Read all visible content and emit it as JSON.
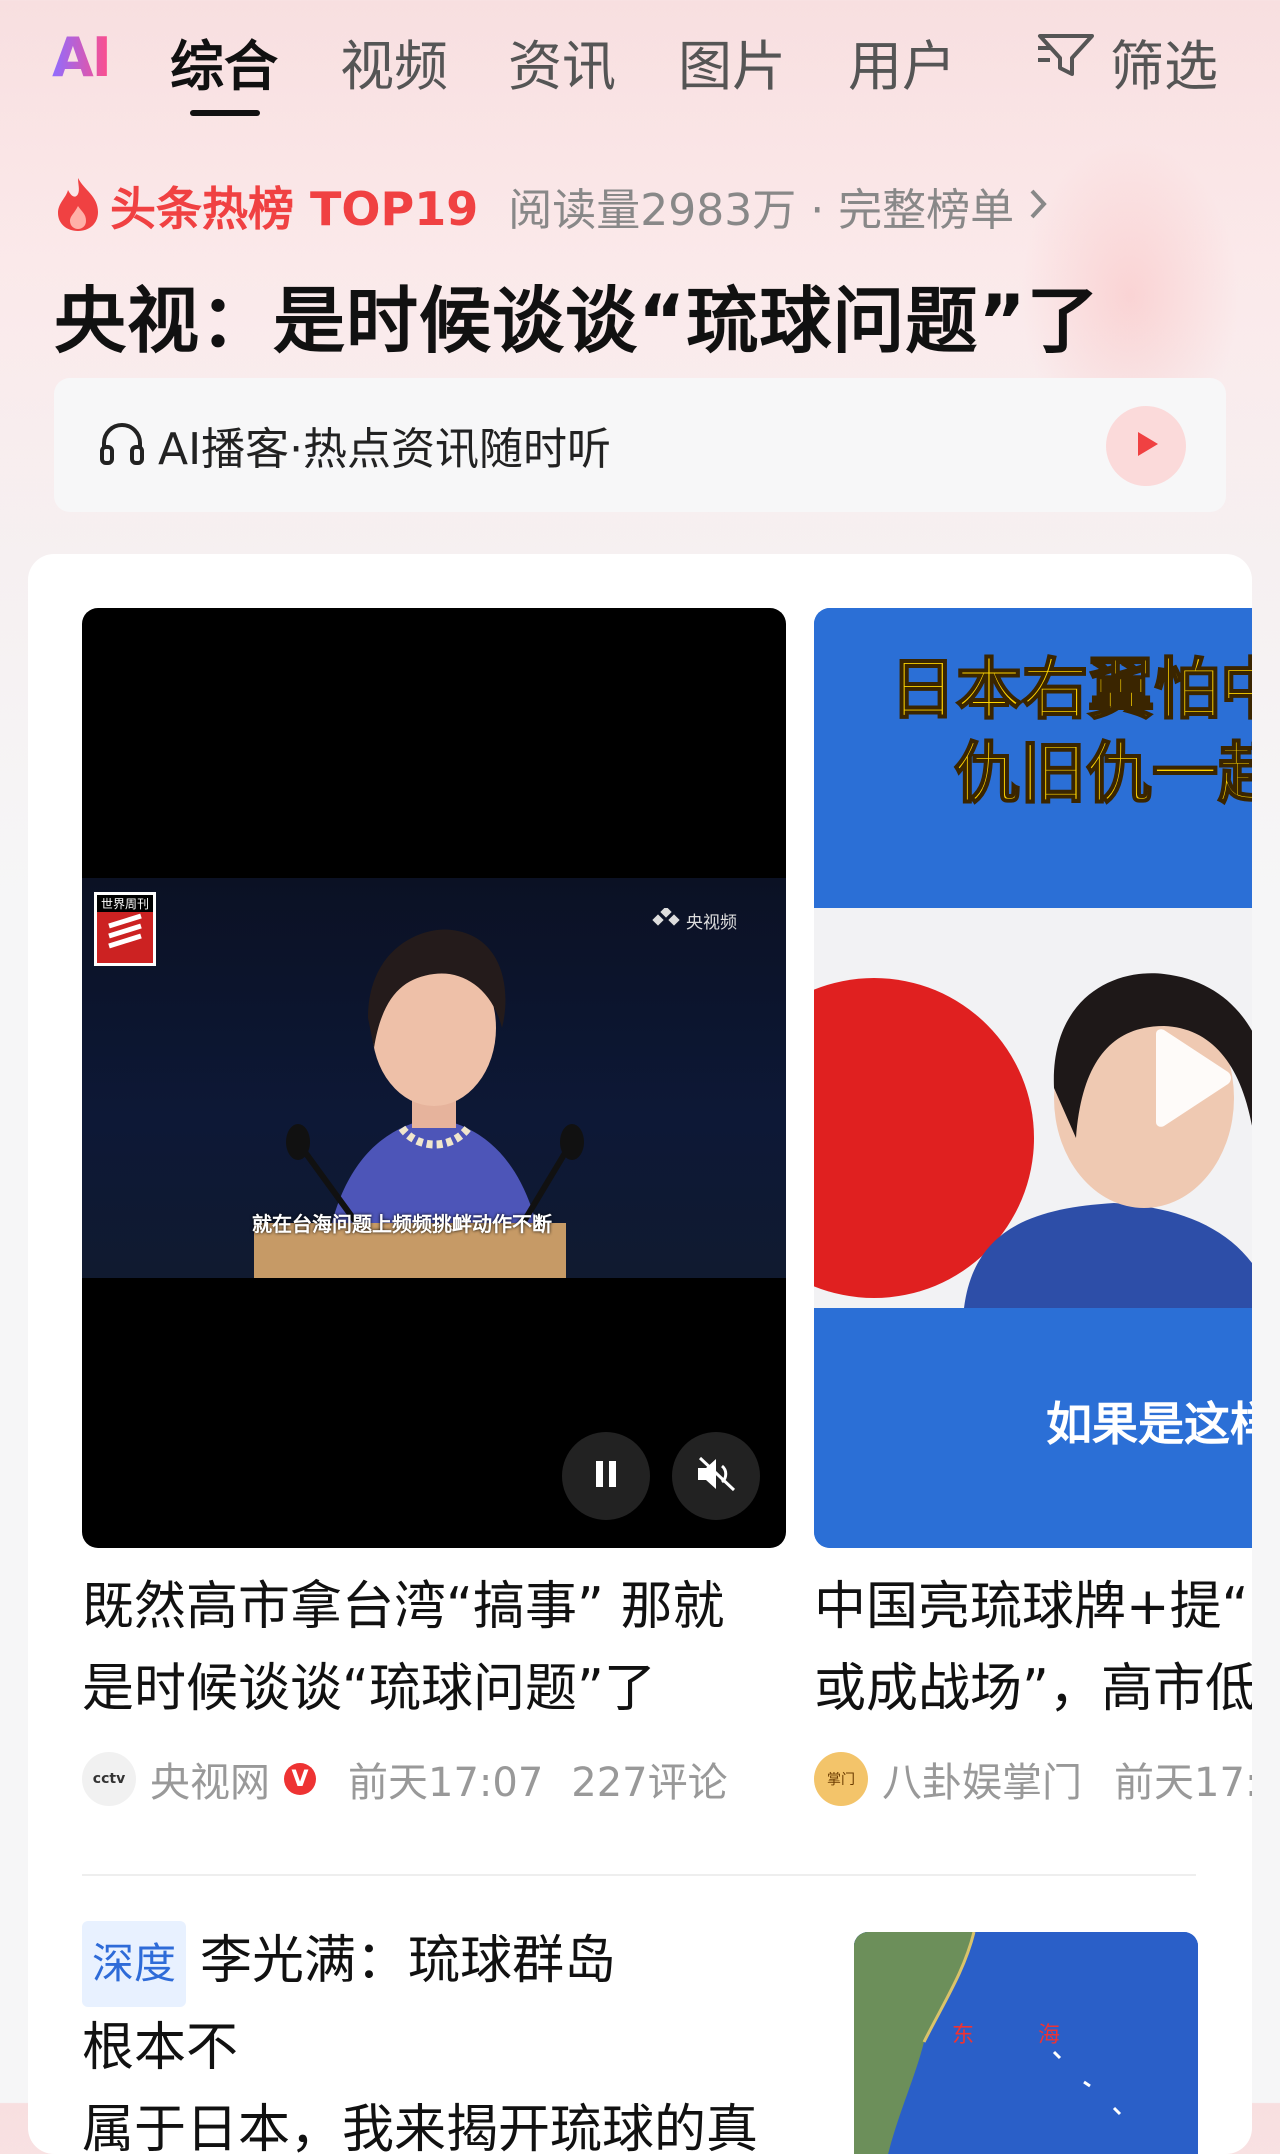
{
  "nav": {
    "logo": "AI",
    "tabs": [
      {
        "label": "综合",
        "active": true
      },
      {
        "label": "视频",
        "active": false
      },
      {
        "label": "资讯",
        "active": false
      },
      {
        "label": "图片",
        "active": false
      },
      {
        "label": "用户",
        "active": false
      }
    ],
    "filter_label": "筛选"
  },
  "hot": {
    "tag": "头条热榜 TOP19",
    "meta": "阅读量2983万 · 完整榜单",
    "headline": "央视：是时候谈谈“琉球问题”了"
  },
  "podcast": {
    "label": "AI播客·热点资讯随时听"
  },
  "videos": [
    {
      "thumb_logo": "世界周刊",
      "thumb_watermark": "央视频",
      "caption": "就在台海问题上频频挑衅动作不断",
      "title_line1": "既然高市拿台湾“搞事” 那就",
      "title_line2": "是时候谈谈“琉球问题”了",
      "source": "央视网",
      "verified_badge": "V",
      "time": "前天17:07",
      "comments": "227评论"
    },
    {
      "banner_line1": "日本右翼怕中",
      "banner_line2": "仇旧仇一起",
      "caption": "如果是这样",
      "title_line1": "中国亮琉球牌+提“",
      "title_line2": "或成战场”，高市低",
      "source": "八卦娱掌门",
      "time": "前天17:"
    }
  ],
  "article": {
    "tag": "深度",
    "title_line1": "李光满：琉球群岛根本不",
    "title_line2": "属于日本，我来揭开琉球的真"
  },
  "colors": {
    "accent_red": "#f04142",
    "tag_blue": "#2e6bd8",
    "banner_blue": "#2b6fd6",
    "banner_yellow": "#ffd400"
  }
}
